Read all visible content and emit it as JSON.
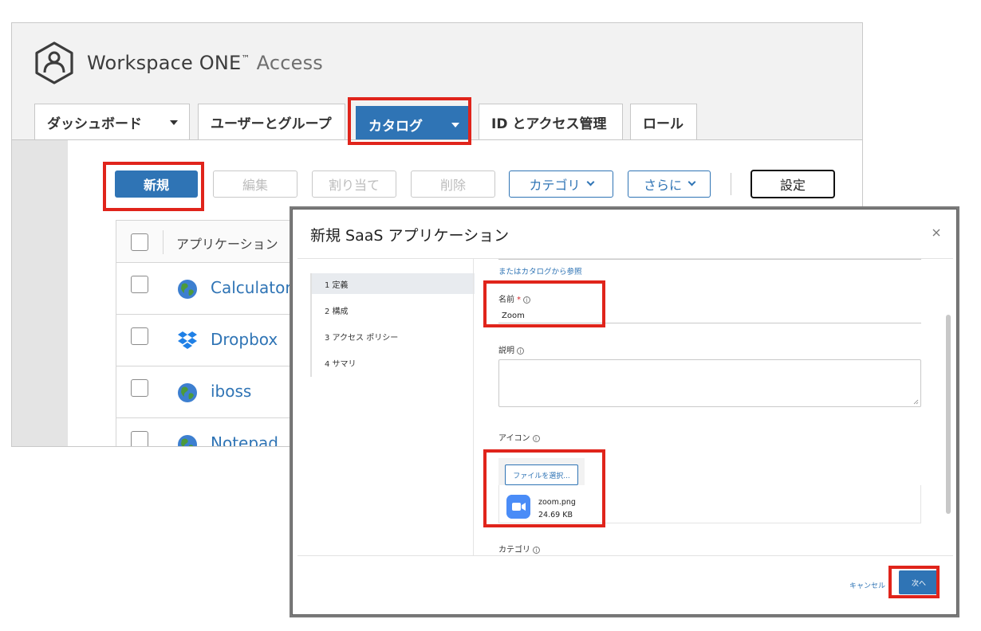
{
  "brand": {
    "name": "Workspace ONE",
    "trademark": "™",
    "product": "Access"
  },
  "tabs": [
    {
      "label": "ダッシュボード",
      "dropdown": true
    },
    {
      "label": "ユーザーとグループ",
      "dropdown": false
    },
    {
      "label": "カタログ",
      "dropdown": true,
      "active": true
    },
    {
      "label": "ID とアクセス管理",
      "dropdown": false
    },
    {
      "label": "ロール",
      "dropdown": false
    }
  ],
  "toolbar": {
    "new_label": "新規",
    "edit_label": "編集",
    "assign_label": "割り当て",
    "delete_label": "削除",
    "category_label": "カテゴリ",
    "more_label": "さらに",
    "settings_label": "設定"
  },
  "table": {
    "column_header": "アプリケーション",
    "rows": [
      {
        "name": "Calculator",
        "icon": "globe-icon"
      },
      {
        "name": "Dropbox",
        "icon": "dropbox-icon"
      },
      {
        "name": "iboss",
        "icon": "globe-icon"
      },
      {
        "name": "Notepad",
        "icon": "globe-icon"
      }
    ]
  },
  "modal": {
    "title": "新規 SaaS アプリケーション",
    "steps": [
      {
        "label": "1 定義",
        "active": true
      },
      {
        "label": "2 構成",
        "active": false
      },
      {
        "label": "3 アクセス ポリシー",
        "active": false
      },
      {
        "label": "4 サマリ",
        "active": false
      }
    ],
    "catalog_link": "またはカタログから参照",
    "name_label": "名前",
    "required_mark": "*",
    "name_value": "Zoom",
    "description_label": "説明",
    "icon_label": "アイコン",
    "file_button": "ファイルを選択...",
    "file_name": "zoom.png",
    "file_size": "24.69 KB",
    "category_label": "カテゴリ",
    "cancel_label": "キャンセル",
    "next_label": "次へ"
  },
  "colors": {
    "accent": "#2f74b5",
    "highlight": "#e0241b",
    "zoom_blue": "#4a8cf7"
  }
}
